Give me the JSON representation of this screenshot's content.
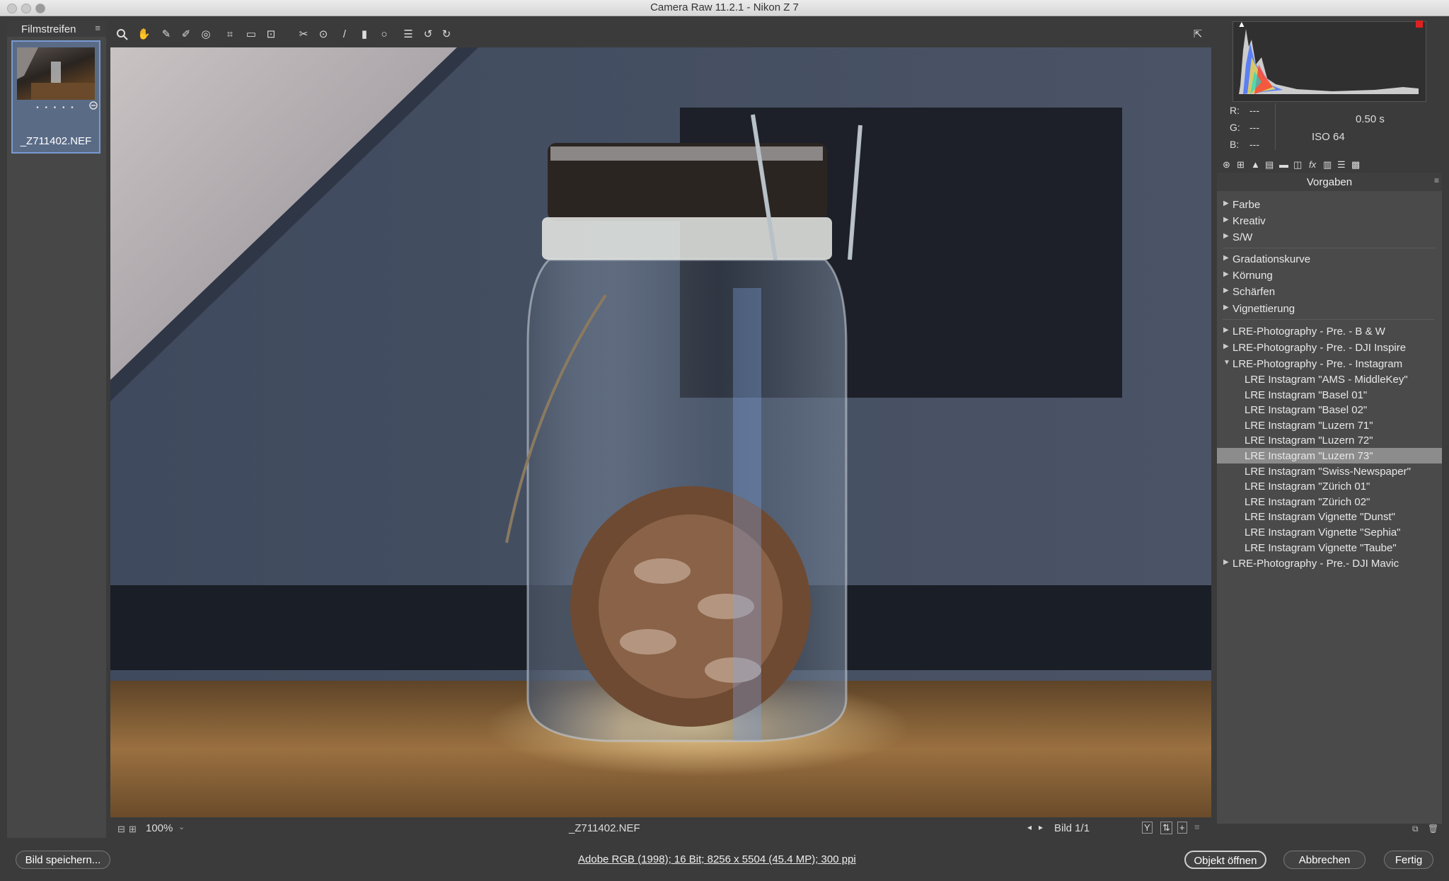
{
  "window": {
    "title": "Camera Raw 11.2.1  -  Nikon Z 7"
  },
  "filmstrip": {
    "header": "Filmstreifen",
    "menu_icon": "≡",
    "thumbnail": {
      "stars": "• • • • •",
      "filename": "_Z711402.NEF"
    }
  },
  "toolbar": {
    "tools": [
      "zoom-icon",
      "hand-icon",
      "white-balance-icon",
      "color-sampler-icon",
      "targeted-adjustment-icon",
      "crop-icon",
      "straighten-icon",
      "transform-icon",
      "spot-removal-icon",
      "red-eye-icon",
      "adjustment-brush-icon",
      "graduated-filter-icon",
      "radial-filter-icon",
      "preferences-icon",
      "rotate-left-icon",
      "rotate-right-icon"
    ],
    "fullscreen_icon": "fullscreen-icon"
  },
  "status": {
    "zoom": "100%",
    "filename": "_Z711402.NEF",
    "page": "Bild 1/1"
  },
  "info": {
    "r_label": "R:",
    "r_value": "---",
    "g_label": "G:",
    "g_value": "---",
    "b_label": "B:",
    "b_value": "---",
    "shutter": "0.50 s",
    "iso": "ISO 64"
  },
  "presets": {
    "header": "Vorgaben",
    "groups1": [
      "Farbe",
      "Kreativ",
      "S/W"
    ],
    "groups2": [
      "Gradationskurve",
      "Körnung",
      "Schärfen",
      "Vignettierung"
    ],
    "groups3": [
      "LRE-Photography - Pre. - B & W",
      "LRE-Photography - Pre. - DJI Inspire",
      "LRE-Photography - Pre. - Instagram"
    ],
    "instagram_items": [
      "LRE Instagram \"AMS - MiddleKey\"",
      "LRE Instagram \"Basel 01\"",
      "LRE Instagram \"Basel 02\"",
      "LRE Instagram \"Luzern 71\"",
      "LRE Instagram \"Luzern 72\"",
      "LRE Instagram \"Luzern 73\"",
      "LRE Instagram \"Swiss-Newspaper\"",
      "LRE Instagram \"Zürich 01\"",
      "LRE Instagram \"Zürich 02\"",
      "LRE Instagram Vignette \"Dunst\"",
      "LRE Instagram Vignette \"Sephia\"",
      "LRE Instagram Vignette \"Taube\""
    ],
    "selected_item": "LRE Instagram \"Luzern 73\"",
    "last_group": "LRE-Photography - Pre.- DJI Mavic"
  },
  "bottom": {
    "save_label": "Bild speichern...",
    "workflow_link": "Adobe RGB (1998); 16 Bit; 8256 x 5504 (45.4 MP); 300 ppi",
    "open_label": "Objekt öffnen",
    "cancel_label": "Abbrechen",
    "done_label": "Fertig"
  },
  "colors": {
    "selection": "#8c8c8c",
    "panel": "#4a4a4a",
    "background": "#3b3b3b"
  }
}
